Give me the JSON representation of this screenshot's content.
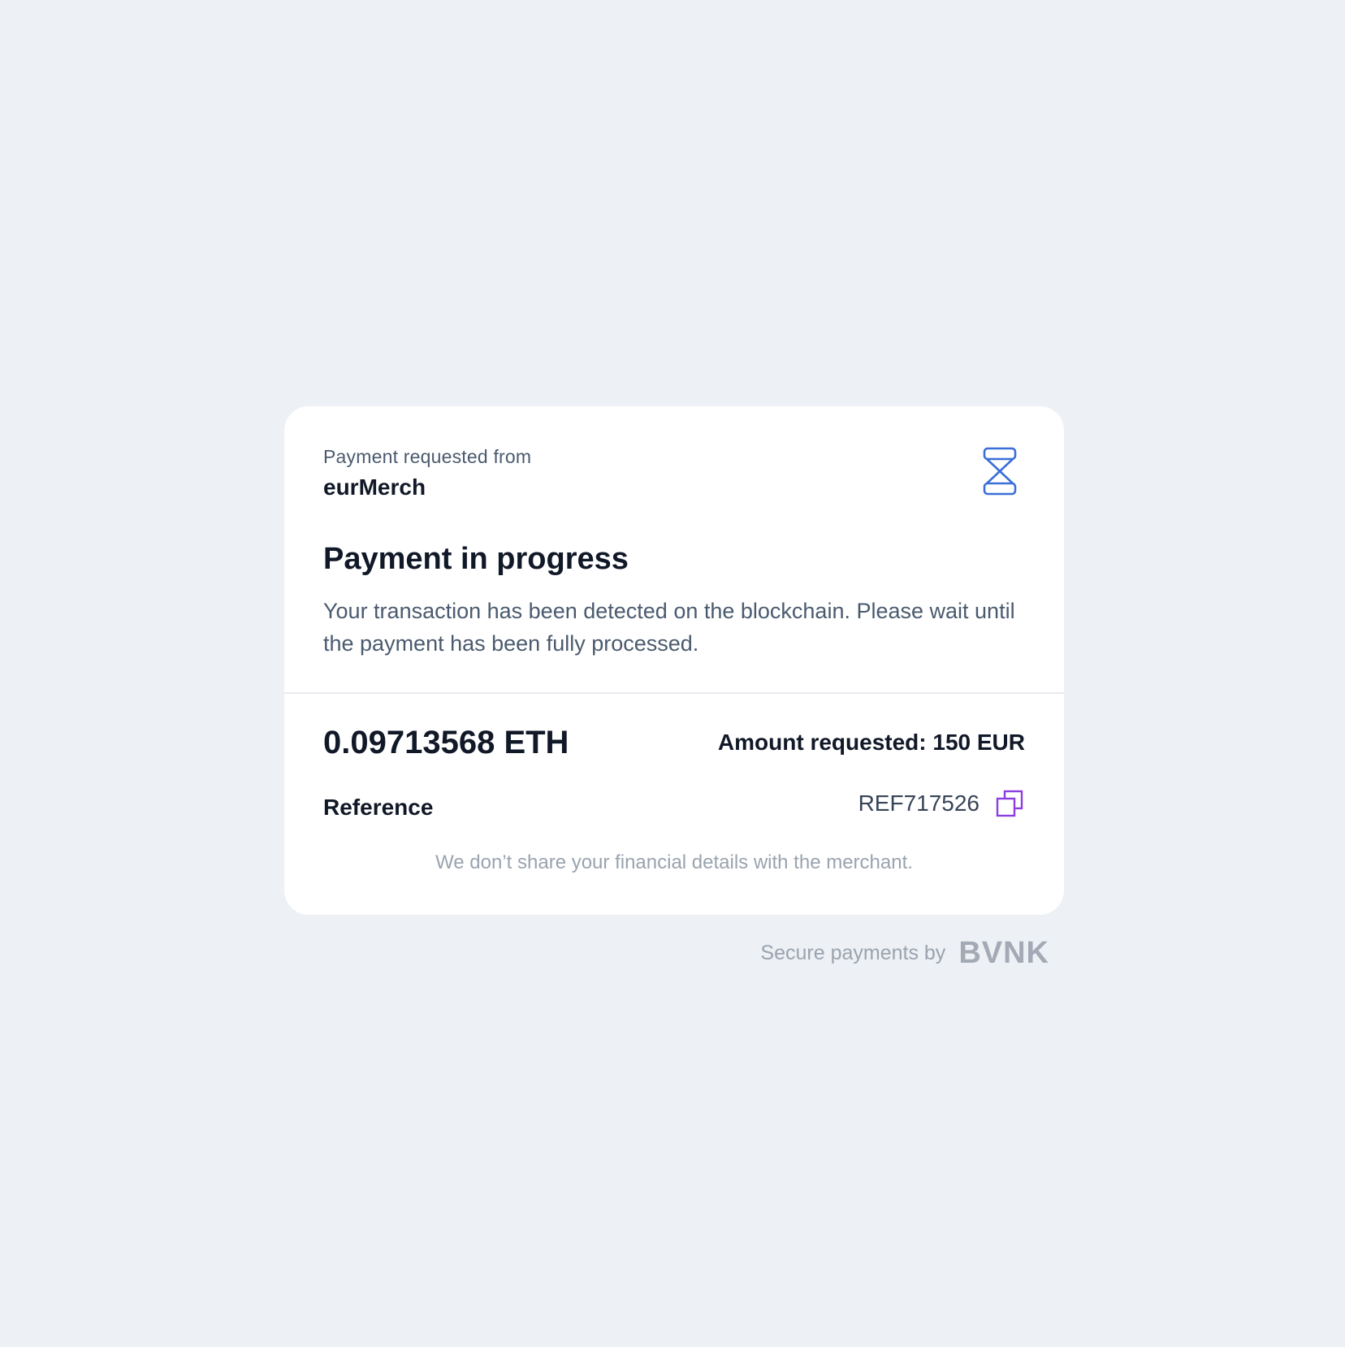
{
  "header": {
    "requested_from_label": "Payment requested from",
    "merchant_name": "eurMerch",
    "status_icon": "hourglass-icon"
  },
  "status": {
    "title": "Payment in progress",
    "description": "Your transaction has been detected on the blockchain. Please wait until the payment has been fully processed."
  },
  "payment": {
    "crypto_amount": "0.09713568 ETH",
    "amount_requested": "Amount requested: 150 EUR",
    "reference_label": "Reference",
    "reference_value": "REF717526",
    "copy_icon": "copy-icon",
    "privacy_note": "We don’t share your financial details with the merchant."
  },
  "footer": {
    "secure_text": "Secure payments by",
    "brand": "BVNK"
  },
  "colors": {
    "background": "#edf0f4",
    "card": "#ffffff",
    "hourglass_blue": "#3b6fd8",
    "copy_purple": "#8b3fe0",
    "text_dark": "#111827",
    "text_muted": "#4a5a6e",
    "text_light": "#9aa3af"
  }
}
